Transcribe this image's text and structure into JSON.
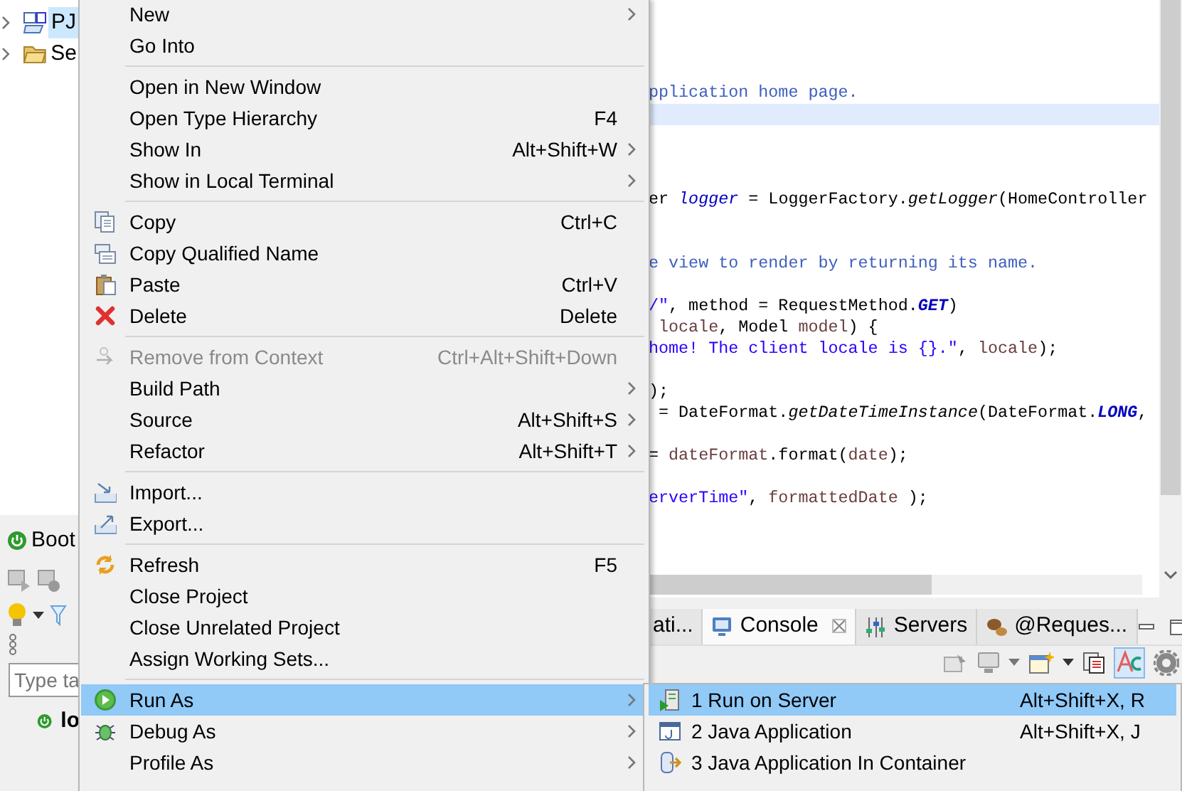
{
  "project_tree": [
    {
      "label": "PJ",
      "selected": true
    },
    {
      "label": "Se",
      "selected": false
    }
  ],
  "boot_panel": {
    "tab": "Boot",
    "filter_placeholder": "Type ta",
    "items": [
      {
        "label": "lo"
      }
    ]
  },
  "editor": {
    "lines": [
      {
        "current": false
      },
      {
        "current": false
      },
      {
        "current": false
      },
      {
        "current": false
      },
      {
        "current": false,
        "segments": [
          {
            "kind": "comment",
            "text": "pplication home page."
          }
        ]
      },
      {
        "current": true
      },
      {
        "current": false
      },
      {
        "current": false
      },
      {
        "current": false
      },
      {
        "current": false,
        "segments": [
          {
            "kind": "plain",
            "text": "er "
          },
          {
            "kind": "field",
            "text": "logger"
          },
          {
            "kind": "plain",
            "text": " = LoggerFactory."
          },
          {
            "kind": "static",
            "text": "getLogger"
          },
          {
            "kind": "plain",
            "text": "(HomeController"
          }
        ]
      },
      {
        "current": false
      },
      {
        "current": false
      },
      {
        "current": false,
        "segments": [
          {
            "kind": "comment",
            "text": "e view to render by returning its name."
          }
        ]
      },
      {
        "current": false
      },
      {
        "current": false,
        "segments": [
          {
            "kind": "string",
            "text": "/\""
          },
          {
            "kind": "plain",
            "text": ", method = RequestMethod."
          },
          {
            "kind": "constant",
            "text": "GET"
          },
          {
            "kind": "plain",
            "text": ")"
          }
        ]
      },
      {
        "current": false,
        "segments": [
          {
            "kind": "local",
            "text": "locale"
          },
          {
            "kind": "plain",
            "text": ", Model "
          },
          {
            "kind": "local",
            "text": "model"
          },
          {
            "kind": "plain",
            "text": ") {"
          }
        ]
      },
      {
        "current": false,
        "segments": [
          {
            "kind": "string",
            "text": "home! The client locale is {}.\""
          },
          {
            "kind": "plain",
            "text": ", "
          },
          {
            "kind": "local",
            "text": "locale"
          },
          {
            "kind": "plain",
            "text": ");"
          }
        ]
      },
      {
        "current": false
      },
      {
        "current": false,
        "segments": [
          {
            "kind": "plain",
            "text": ");"
          }
        ]
      },
      {
        "current": false,
        "segments": [
          {
            "kind": "plain",
            "text": " = DateFormat."
          },
          {
            "kind": "static",
            "text": "getDateTimeInstance"
          },
          {
            "kind": "plain",
            "text": "(DateFormat."
          },
          {
            "kind": "constant",
            "text": "LONG"
          },
          {
            "kind": "plain",
            "text": ","
          }
        ]
      },
      {
        "current": false
      },
      {
        "current": false,
        "segments": [
          {
            "kind": "plain",
            "text": "= "
          },
          {
            "kind": "local",
            "text": "dateFormat"
          },
          {
            "kind": "plain",
            "text": ".format("
          },
          {
            "kind": "local",
            "text": "date"
          },
          {
            "kind": "plain",
            "text": ");"
          }
        ]
      },
      {
        "current": false
      },
      {
        "current": false,
        "segments": [
          {
            "kind": "string",
            "text": "erverTime\""
          },
          {
            "kind": "plain",
            "text": ", "
          },
          {
            "kind": "local",
            "text": "formattedDate"
          },
          {
            "kind": "plain",
            "text": " );"
          }
        ]
      }
    ]
  },
  "bottom_panel": {
    "tabs": [
      {
        "label": "ati...",
        "selected": false,
        "closable": false
      },
      {
        "label": "Console",
        "selected": true,
        "closable": true
      },
      {
        "label": "Servers",
        "selected": false,
        "closable": false
      },
      {
        "label": "@Reques...",
        "selected": false,
        "closable": false
      }
    ]
  },
  "context_menu": {
    "items": [
      {
        "kind": "item",
        "label": "New",
        "has_submenu": true,
        "disabled": false,
        "selected": false
      },
      {
        "kind": "item",
        "label": "Go Into",
        "has_submenu": false,
        "disabled": false,
        "selected": false
      },
      {
        "kind": "separator"
      },
      {
        "kind": "item",
        "label": "Open in New Window",
        "has_submenu": false,
        "disabled": false,
        "selected": false
      },
      {
        "kind": "item",
        "label": "Open Type Hierarchy",
        "shortcut": "F4",
        "has_submenu": false,
        "disabled": false,
        "selected": false
      },
      {
        "kind": "item",
        "label": "Show In",
        "shortcut": "Alt+Shift+W",
        "has_submenu": true,
        "disabled": false,
        "selected": false
      },
      {
        "kind": "item",
        "label": "Show in Local Terminal",
        "has_submenu": true,
        "disabled": false,
        "selected": false
      },
      {
        "kind": "separator"
      },
      {
        "kind": "item",
        "label": "Copy",
        "shortcut": "Ctrl+C",
        "has_submenu": false,
        "disabled": false,
        "selected": false
      },
      {
        "kind": "item",
        "label": "Copy Qualified Name",
        "has_submenu": false,
        "disabled": false,
        "selected": false
      },
      {
        "kind": "item",
        "label": "Paste",
        "shortcut": "Ctrl+V",
        "has_submenu": false,
        "disabled": false,
        "selected": false
      },
      {
        "kind": "item",
        "label": "Delete",
        "shortcut": "Delete",
        "has_submenu": false,
        "disabled": false,
        "selected": false
      },
      {
        "kind": "separator"
      },
      {
        "kind": "item",
        "label": "Remove from Context",
        "shortcut": "Ctrl+Alt+Shift+Down",
        "has_submenu": false,
        "disabled": true,
        "selected": false
      },
      {
        "kind": "item",
        "label": "Build Path",
        "has_submenu": true,
        "disabled": false,
        "selected": false
      },
      {
        "kind": "item",
        "label": "Source",
        "shortcut": "Alt+Shift+S",
        "has_submenu": true,
        "disabled": false,
        "selected": false
      },
      {
        "kind": "item",
        "label": "Refactor",
        "shortcut": "Alt+Shift+T",
        "has_submenu": true,
        "disabled": false,
        "selected": false
      },
      {
        "kind": "separator"
      },
      {
        "kind": "item",
        "label": "Import...",
        "has_submenu": false,
        "disabled": false,
        "selected": false
      },
      {
        "kind": "item",
        "label": "Export...",
        "has_submenu": false,
        "disabled": false,
        "selected": false
      },
      {
        "kind": "separator"
      },
      {
        "kind": "item",
        "label": "Refresh",
        "shortcut": "F5",
        "has_submenu": false,
        "disabled": false,
        "selected": false
      },
      {
        "kind": "item",
        "label": "Close Project",
        "has_submenu": false,
        "disabled": false,
        "selected": false
      },
      {
        "kind": "item",
        "label": "Close Unrelated Project",
        "has_submenu": false,
        "disabled": false,
        "selected": false
      },
      {
        "kind": "item",
        "label": "Assign Working Sets...",
        "has_submenu": false,
        "disabled": false,
        "selected": false
      },
      {
        "kind": "separator"
      },
      {
        "kind": "item",
        "label": "Run As",
        "has_submenu": true,
        "disabled": false,
        "selected": true
      },
      {
        "kind": "item",
        "label": "Debug As",
        "has_submenu": true,
        "disabled": false,
        "selected": false
      },
      {
        "kind": "item",
        "label": "Profile As",
        "has_submenu": true,
        "disabled": false,
        "selected": false
      }
    ]
  },
  "submenu": {
    "items": [
      {
        "label": "1 Run on Server",
        "shortcut": "Alt+Shift+X, R",
        "selected": true
      },
      {
        "label": "2 Java Application",
        "shortcut": "Alt+Shift+X, J",
        "selected": false
      },
      {
        "label": "3 Java Application In Container",
        "selected": false
      }
    ]
  }
}
